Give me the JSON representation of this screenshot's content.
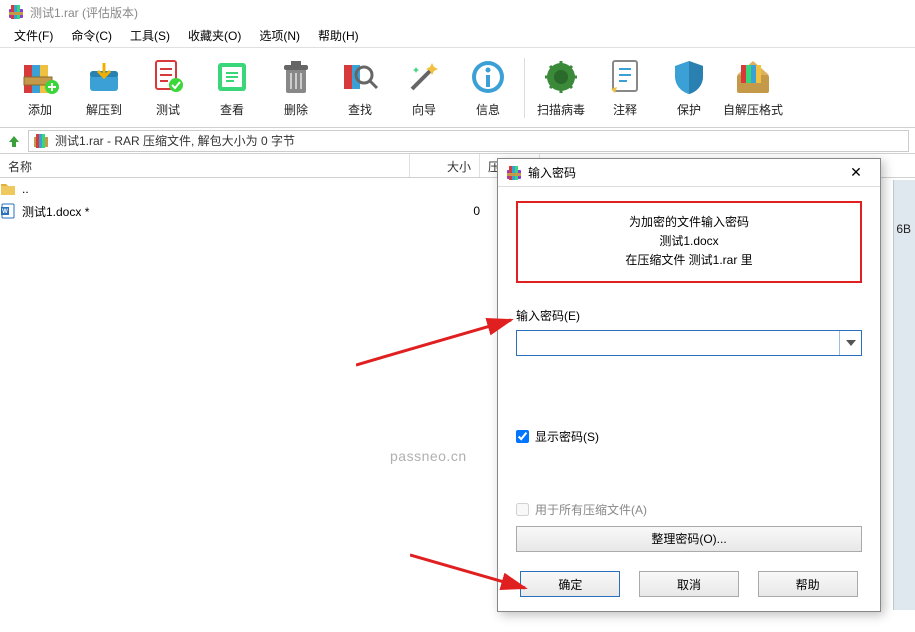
{
  "title": "测试1.rar (评估版本)",
  "menus": [
    "文件(F)",
    "命令(C)",
    "工具(S)",
    "收藏夹(O)",
    "选项(N)",
    "帮助(H)"
  ],
  "toolbar": [
    {
      "label": "添加"
    },
    {
      "label": "解压到"
    },
    {
      "label": "测试"
    },
    {
      "label": "查看"
    },
    {
      "label": "删除"
    },
    {
      "label": "查找"
    },
    {
      "label": "向导"
    },
    {
      "label": "信息"
    },
    {
      "label": "扫描病毒"
    },
    {
      "label": "注释"
    },
    {
      "label": "保护"
    },
    {
      "label": "自解压格式"
    }
  ],
  "path": "测试1.rar - RAR 压缩文件, 解包大小为 0 字节",
  "columns": {
    "name": "名称",
    "size": "大小",
    "packed": "压缩"
  },
  "rows": [
    {
      "name": "..",
      "size": "",
      "type": "folder"
    },
    {
      "name": "测试1.docx *",
      "size": "0",
      "type": "doc"
    }
  ],
  "dialog": {
    "title": "输入密码",
    "info1": "为加密的文件输入密码",
    "info2": "测试1.docx",
    "info3": "在压缩文件 测试1.rar 里",
    "pwd_label": "输入密码(E)",
    "show_pwd": "显示密码(S)",
    "show_pwd_checked": true,
    "all_archives": "用于所有压缩文件(A)",
    "all_archives_checked": false,
    "organize": "整理密码(O)...",
    "ok": "确定",
    "cancel": "取消",
    "help": "帮助"
  },
  "watermark": "passneo.cn",
  "rightlabel": "6B"
}
